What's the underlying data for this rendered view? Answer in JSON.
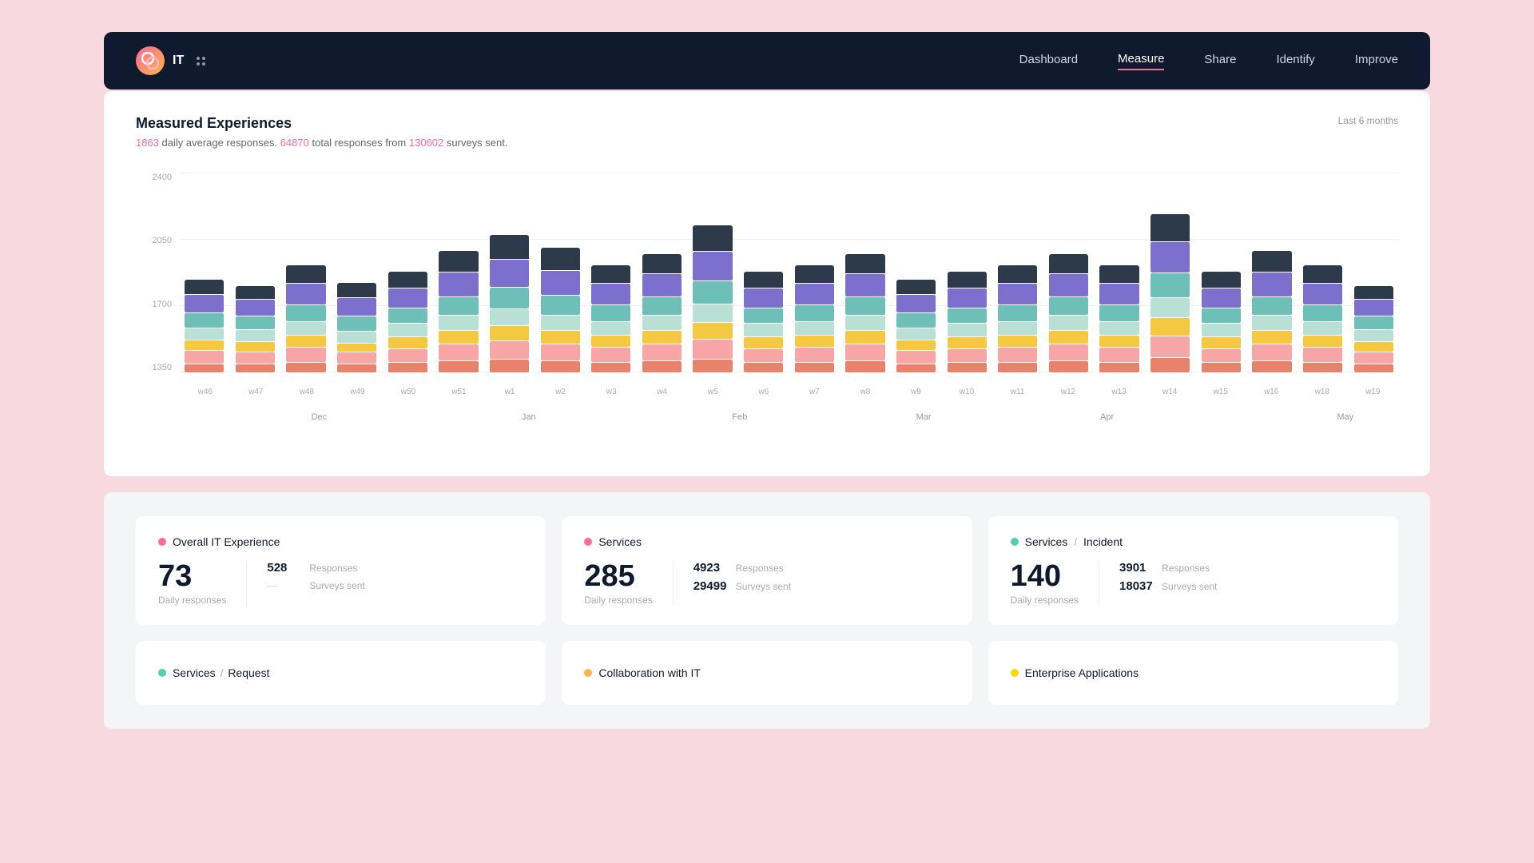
{
  "nav": {
    "brand": "IT",
    "links": [
      "Dashboard",
      "Measure",
      "Share",
      "Identify",
      "Improve"
    ],
    "active": "Measure"
  },
  "chart": {
    "title": "Measured Experiences",
    "subtitle_daily": "1863",
    "subtitle_total": "64870",
    "subtitle_surveys": "130602",
    "subtitle_text_before": " daily average responses. ",
    "subtitle_text_mid": " total responses from ",
    "subtitle_text_after": " surveys sent.",
    "period_label": "Last 6 months",
    "y_labels": [
      "2400",
      "2050",
      "1700",
      "1350"
    ],
    "weeks": [
      "w46",
      "w47",
      "w48",
      "w49",
      "w50",
      "w51",
      "w1",
      "w2",
      "w3",
      "w4",
      "w5",
      "w6",
      "w7",
      "w8",
      "w9",
      "w10",
      "w11",
      "w12",
      "w13",
      "w14",
      "w15",
      "w16",
      "w18",
      "w19"
    ],
    "months": [
      {
        "label": "Dec",
        "col": 2
      },
      {
        "label": "Jan",
        "col": 5
      },
      {
        "label": "Feb",
        "col": 9
      },
      {
        "label": "Mar",
        "col": 13
      },
      {
        "label": "Apr",
        "col": 17
      },
      {
        "label": "May",
        "col": 21
      }
    ]
  },
  "cards": [
    {
      "dot_color": "#ff6b9d",
      "title": "Overall IT Experience",
      "score": "73",
      "score_label": "Daily responses",
      "stat1_num": "528",
      "stat1_label": "Responses",
      "stat2_num": "—",
      "stat2_label": "Surveys sent"
    },
    {
      "dot_color": "#ff6b9d",
      "title": "Services",
      "score": "285",
      "score_label": "Daily responses",
      "stat1_num": "4923",
      "stat1_label": "Responses",
      "stat2_num": "29499",
      "stat2_label": "Surveys sent"
    },
    {
      "dot_color": "#4fd1b5",
      "title": "Services",
      "title2": "Incident",
      "score": "140",
      "score_label": "Daily responses",
      "stat1_num": "3901",
      "stat1_label": "Responses",
      "stat2_num": "18037",
      "stat2_label": "Surveys sent"
    }
  ],
  "bottom_cards": [
    {
      "dot_color": "#4fd1b5",
      "title": "Services",
      "title2": "Request"
    },
    {
      "dot_color": "#ffb347",
      "title": "Collaboration with IT"
    },
    {
      "dot_color": "#ffd700",
      "title": "Enterprise Applications"
    }
  ]
}
